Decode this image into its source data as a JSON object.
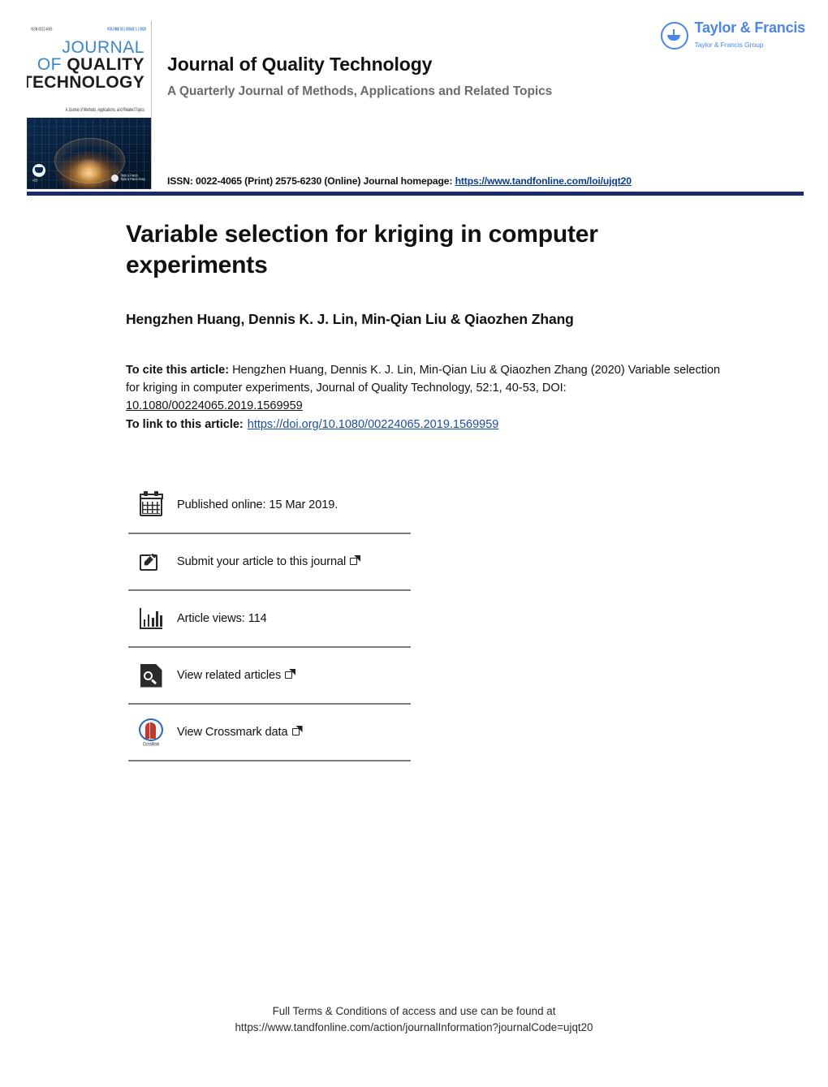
{
  "header": {
    "journal_title": "Journal of Quality Technology",
    "journal_subtitle": "A Quarterly Journal of Methods, Applications and Related Topics",
    "issn_prefix": "ISSN: 0022-4065 (Print) 2575-6230 (Online) Journal homepage:",
    "issn_link": "https://www.tandfonline.com/loi/ujqt20",
    "publisher": {
      "name": "Taylor & Francis",
      "group": "Taylor & Francis Group",
      "logo_color": "#4a86e8"
    },
    "rule_color": "#1b2a6b"
  },
  "cover": {
    "issn_small": "ISSN 0022-4065",
    "volume_small": "VOLUME 52 | ISSUE 1 | 2020",
    "line1": "JOURNAL",
    "line2_of": "OF ",
    "line2_quality": "QUALITY",
    "line3": "TECHNOLOGY",
    "tagline": "A Journal of Methods, Applications, and Related Topics",
    "asq_label": "ASQ",
    "tf_label_1": "Taylor & Francis",
    "tf_label_2": "Taylor & Francis Group"
  },
  "article": {
    "title": "Variable selection for kriging in computer experiments",
    "authors": "Hengzhen Huang, Dennis K. J. Lin, Min-Qian Liu & Qiaozhen Zhang",
    "cite_lead": "To cite this article:",
    "cite_text": " Hengzhen Huang, Dennis K. J. Lin, Min-Qian Liu & Qiaozhen Zhang (2020) Variable selection for kriging in computer experiments, Journal of Quality Technology, 52:1, 40-53, DOI: ",
    "cite_doi": "10.1080/00224065.2019.1569959",
    "link_lead": "To link to this article:",
    "link_url": "https://doi.org/10.1080/00224065.2019.1569959"
  },
  "actions": [
    {
      "icon": "calendar-icon",
      "label": "Published online: 15 Mar 2019.",
      "external": false
    },
    {
      "icon": "submit-icon",
      "label": "Submit your article to this journal",
      "external": true
    },
    {
      "icon": "bar-chart-icon",
      "label": "Article views: 114",
      "external": false
    },
    {
      "icon": "related-articles-icon",
      "label": "View related articles",
      "external": true
    },
    {
      "icon": "crossmark-icon",
      "label": "View Crossmark data",
      "external": true
    }
  ],
  "footer": {
    "line1": "Full Terms & Conditions of access and use can be found at",
    "line2": "https://www.tandfonline.com/action/journalInformation?journalCode=ujqt20"
  }
}
